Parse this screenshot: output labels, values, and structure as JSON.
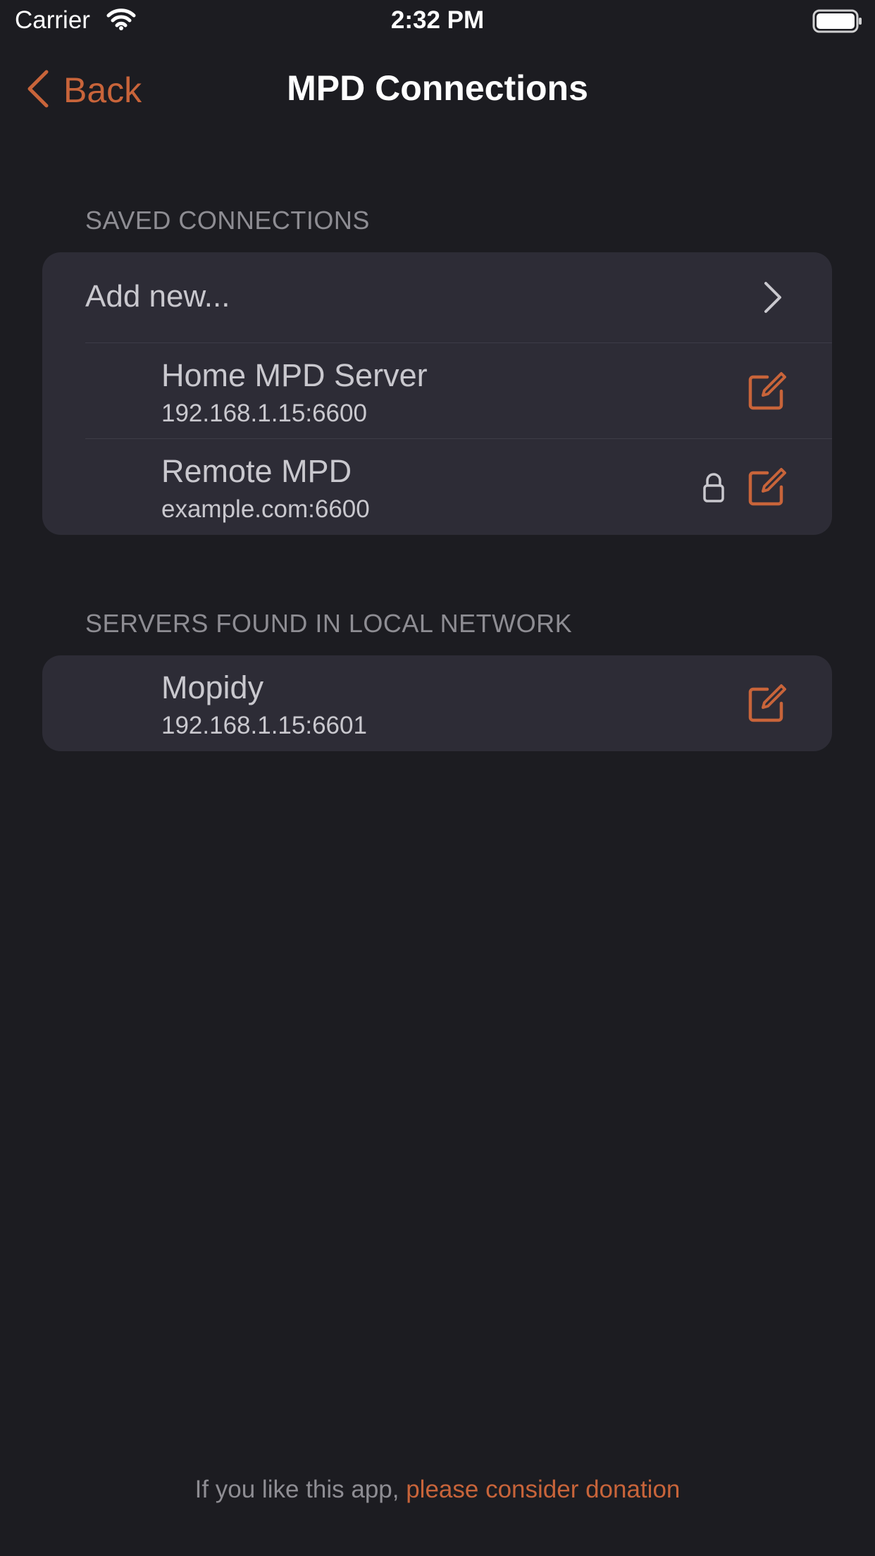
{
  "status_bar": {
    "carrier": "Carrier",
    "time": "2:32 PM",
    "wifi_icon": "wifi-icon",
    "battery_icon": "battery-full-icon"
  },
  "nav": {
    "back_label": "Back",
    "back_icon": "chevron-left-icon",
    "title": "MPD Connections"
  },
  "saved_section": {
    "header": "SAVED CONNECTIONS",
    "add_new_label": "Add new...",
    "add_new_icon": "chevron-right-icon",
    "items": [
      {
        "name": "Home MPD Server",
        "address": "192.168.1.15:6600",
        "locked": false,
        "edit_icon": "edit-icon"
      },
      {
        "name": "Remote MPD",
        "address": "example.com:6600",
        "locked": true,
        "lock_icon": "lock-icon",
        "edit_icon": "edit-icon"
      }
    ]
  },
  "local_section": {
    "header": "SERVERS FOUND IN LOCAL NETWORK",
    "items": [
      {
        "name": "Mopidy",
        "address": "192.168.1.15:6601",
        "edit_icon": "edit-icon"
      }
    ]
  },
  "footer": {
    "text": "If you like this app, ",
    "link": "please consider donation"
  },
  "colors": {
    "background": "#1c1c21",
    "group_background": "#2d2c36",
    "accent": "#c8643a",
    "primary_text": "#c9c8ce",
    "secondary_text": "#8e8d93",
    "separator": "#3d3c47"
  }
}
